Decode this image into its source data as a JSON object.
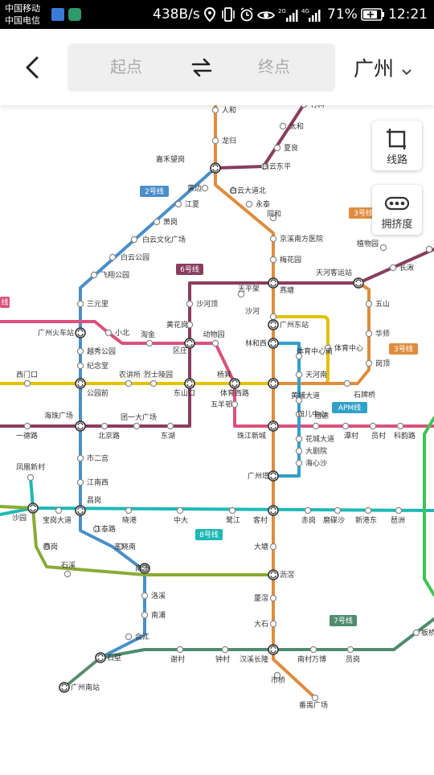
{
  "status_bar": {
    "carrier1": "中国移动",
    "carrier2": "中国电信",
    "speed": "438B/s",
    "battery": "71%",
    "time": "12:21"
  },
  "header": {
    "origin_placeholder": "起点",
    "destination_placeholder": "终点",
    "city": "广州"
  },
  "buttons": {
    "lines_label": "线路",
    "crowding_label": "拥挤度"
  },
  "colors": {
    "line1": "#e3c200",
    "line2": "#4a8fc9",
    "line3": "#df8c3e",
    "line5": "#d9527b",
    "line6": "#8a3d5e",
    "line7": "#4f8c6c",
    "line8": "#1db9b5",
    "line13": "#8aab36",
    "line14": "#3fc456",
    "apm": "#31a0c9",
    "guangfo": "#5a8d70"
  },
  "line_tags": [
    {
      "text": "2号线",
      "color": "#4a8fc9"
    },
    {
      "text": "3号线",
      "color": "#df8c3e"
    },
    {
      "text": "6号线",
      "color": "#8a3d5e"
    },
    {
      "text": "3号线",
      "color": "#df8c3e"
    },
    {
      "text": "APM线",
      "color": "#31a0c9"
    },
    {
      "text": "8号线",
      "color": "#1db9b5"
    },
    {
      "text": "7号线",
      "color": "#4f8c6c"
    },
    {
      "text": "线",
      "color": "#d9527b"
    }
  ],
  "stations": [
    "人和",
    "龙归",
    "嘉禾望岗",
    "夏良",
    "白云东平",
    "太和",
    "竹料",
    "白云大道北",
    "永泰",
    "同和",
    "京溪南方医院",
    "梅花园",
    "燕塘",
    "天河客运站",
    "长湫",
    "植物园",
    "黄边",
    "江夏",
    "萧岗",
    "白云文化广场",
    "白云公园",
    "飞翔公园",
    "三元里",
    "广州火车站",
    "小北",
    "淘金",
    "区庄",
    "动物园",
    "越秀公园",
    "纪念堂",
    "公园前",
    "农讲所",
    "烈士陵园",
    "东山口",
    "杨箕",
    "体育西路",
    "沙河顶",
    "黄花岗",
    "沙河",
    "天平架",
    "林和西",
    "广州东站",
    "体育中心",
    "天河南",
    "石牌桥",
    "岗顶",
    "华师",
    "五山",
    "体育中心南",
    "西门口",
    "海珠广场",
    "一德路",
    "北京路",
    "团一大广场",
    "东湖",
    "五羊邨",
    "珠江新城",
    "黄埔大道",
    "妇儿中心",
    "猎德",
    "潭村",
    "员村",
    "科韵路",
    "花城大道",
    "大剧院",
    "海心沙",
    "广州塔",
    "市二宫",
    "江南西",
    "昌岗",
    "凤凰新村",
    "沙园",
    "宝岗大道",
    "晓港",
    "中大",
    "鹭江",
    "客村",
    "赤岗",
    "磨碟沙",
    "新港东",
    "琶洲",
    "江泰路",
    "东晓南",
    "燕岗",
    "石溪",
    "南洲",
    "大塘",
    "沥滘",
    "厦滘",
    "大石",
    "汉溪长隆",
    "市桥",
    "番禺广场",
    "洛溪",
    "南浦",
    "会江",
    "石壁",
    "谢村",
    "钟村",
    "南村万博",
    "员岗",
    "板桥",
    "广州南站",
    "坑"
  ]
}
